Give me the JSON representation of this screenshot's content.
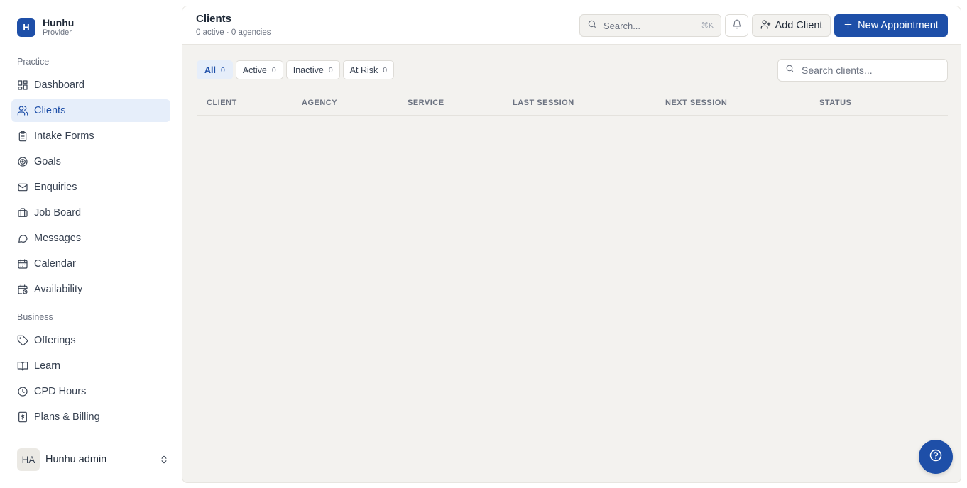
{
  "brand": {
    "logo_letter": "H",
    "name": "Hunhu",
    "role": "Provider"
  },
  "sidebar": {
    "sections": [
      {
        "label": "Practice"
      },
      {
        "label": "Business"
      }
    ],
    "items": [
      {
        "label": "Dashboard",
        "icon": "dashboard-icon"
      },
      {
        "label": "Clients",
        "icon": "users-icon",
        "active": true
      },
      {
        "label": "Intake Forms",
        "icon": "clipboard-icon"
      },
      {
        "label": "Goals",
        "icon": "target-icon"
      },
      {
        "label": "Enquiries",
        "icon": "mail-icon"
      },
      {
        "label": "Job Board",
        "icon": "briefcase-icon"
      },
      {
        "label": "Messages",
        "icon": "message-icon"
      },
      {
        "label": "Calendar",
        "icon": "calendar-icon"
      },
      {
        "label": "Availability",
        "icon": "calendar-clock-icon"
      },
      {
        "label": "Offerings",
        "icon": "tag-icon"
      },
      {
        "label": "Learn",
        "icon": "book-icon"
      },
      {
        "label": "CPD Hours",
        "icon": "clock-icon"
      },
      {
        "label": "Plans & Billing",
        "icon": "receipt-icon"
      }
    ]
  },
  "user": {
    "initials": "HA",
    "name": "Hunhu admin"
  },
  "header": {
    "title": "Clients",
    "subtitle": "0 active · 0 agencies",
    "search_placeholder": "Search...",
    "search_shortcut": "⌘K",
    "add_client_label": "Add Client",
    "new_appointment_label": "New Appointment"
  },
  "filters": [
    {
      "label": "All",
      "count": "0",
      "active": true
    },
    {
      "label": "Active",
      "count": "0"
    },
    {
      "label": "Inactive",
      "count": "0"
    },
    {
      "label": "At Risk",
      "count": "0"
    }
  ],
  "client_search": {
    "placeholder": "Search clients..."
  },
  "table": {
    "columns": [
      "CLIENT",
      "AGENCY",
      "SERVICE",
      "LAST SESSION",
      "NEXT SESSION",
      "STATUS"
    ],
    "rows": []
  },
  "colors": {
    "accent": "#1e4fa8",
    "active_bg": "#e6eefa",
    "main_bg": "#f3f2ef"
  }
}
